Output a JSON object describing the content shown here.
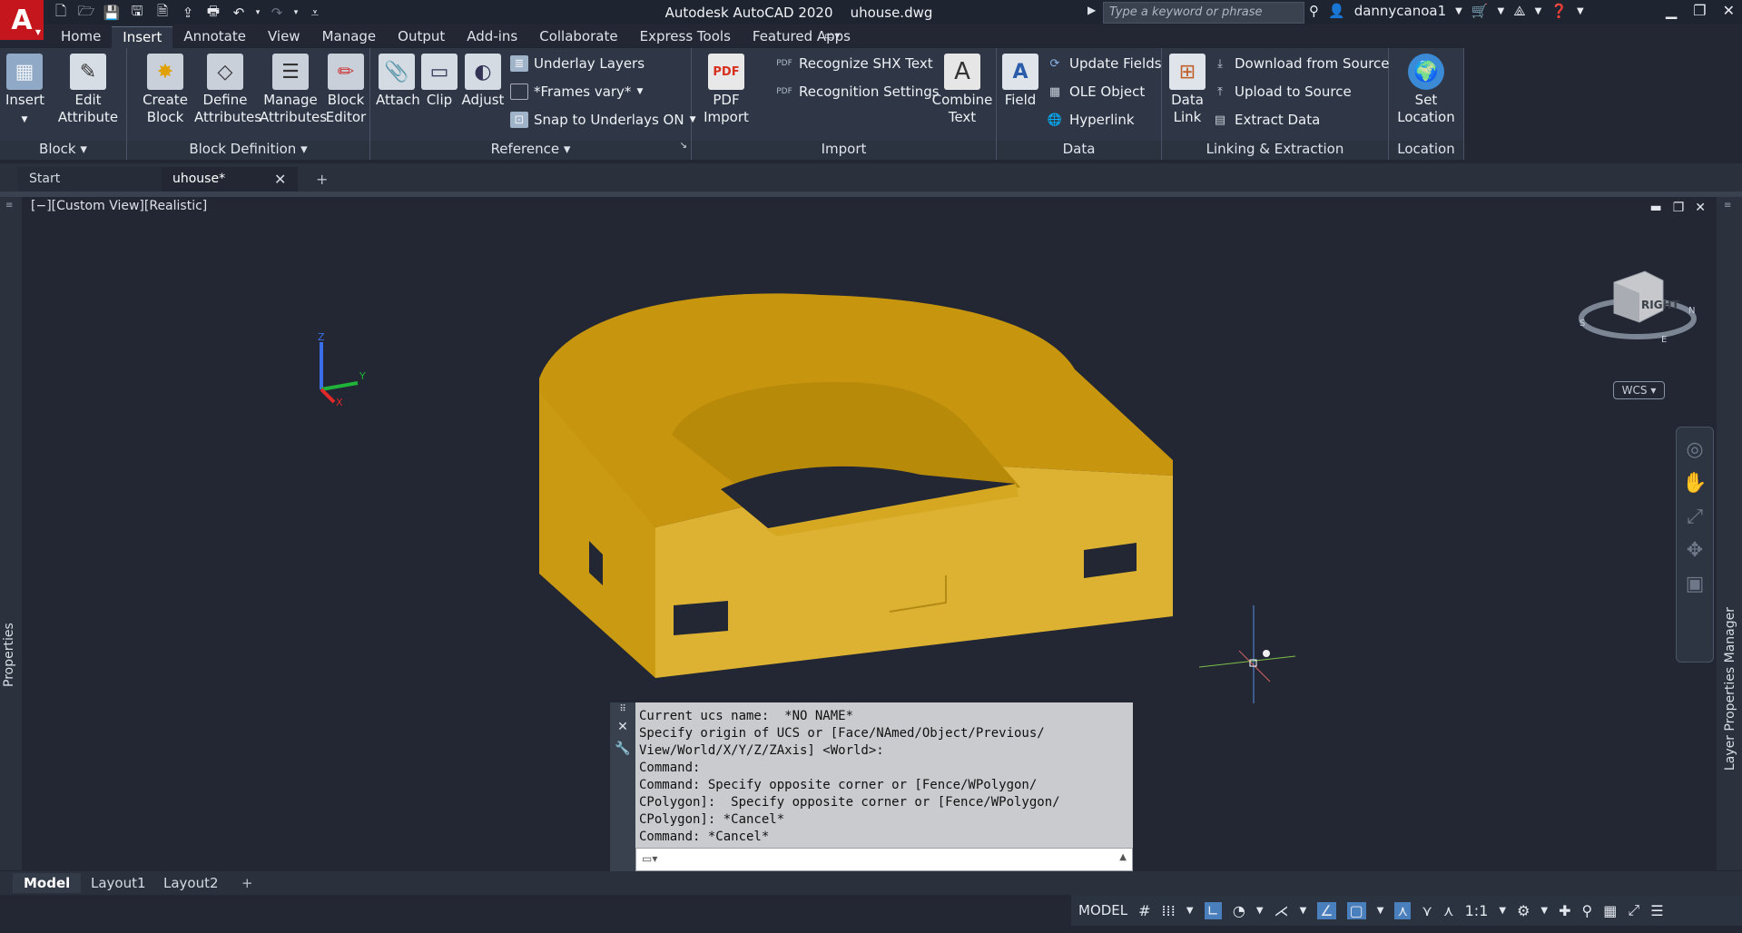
{
  "app": {
    "logo": "A",
    "title": "Autodesk AutoCAD 2020    uhouse.dwg",
    "search_placeholder": "Type a keyword or phrase",
    "username": "dannycanoa1"
  },
  "menu_tabs": [
    "Home",
    "Insert",
    "Annotate",
    "View",
    "Manage",
    "Output",
    "Add-ins",
    "Collaborate",
    "Express Tools",
    "Featured Apps"
  ],
  "active_menu_tab": "Insert",
  "ribbon": {
    "block": {
      "title": "Block",
      "insert": "Insert",
      "edit_attribute": [
        "Edit",
        "Attribute"
      ]
    },
    "block_definition": {
      "title": "Block Definition",
      "create_block": [
        "Create",
        "Block"
      ],
      "define_attributes": [
        "Define",
        "Attributes"
      ],
      "manage_attributes": [
        "Manage",
        "Attributes"
      ],
      "block_editor": [
        "Block",
        "Editor"
      ]
    },
    "reference": {
      "title": "Reference",
      "attach": "Attach",
      "clip": "Clip",
      "adjust": "Adjust",
      "underlay_layers": "Underlay Layers",
      "frames_vary": "*Frames vary*",
      "snap_to_underlays": "Snap to Underlays ON"
    },
    "import": {
      "title": "Import",
      "pdf_import": [
        "PDF",
        "Import"
      ],
      "recognize_shx": "Recognize SHX Text",
      "recognition_settings": "Recognition Settings",
      "combine_text": [
        "Combine",
        "Text"
      ]
    },
    "data": {
      "title": "Data",
      "field": "Field",
      "update_fields": "Update Fields",
      "ole_object": "OLE Object",
      "hyperlink": "Hyperlink"
    },
    "linking": {
      "title": "Linking & Extraction",
      "data_link": [
        "Data",
        "Link"
      ],
      "download_from_source": "Download from Source",
      "upload_to_source": "Upload to Source",
      "extract_data": "Extract  Data"
    },
    "location": {
      "title": "Location",
      "set_location": [
        "Set",
        "Location"
      ]
    }
  },
  "file_tabs": {
    "start": "Start",
    "current": "uhouse*"
  },
  "viewport": {
    "label": "[−][Custom View][Realistic]",
    "viewcube_face": "RIGHT",
    "wcs": "WCS"
  },
  "palettes": {
    "left": "Properties",
    "right": "Layer Properties Manager"
  },
  "command_history": [
    "Current ucs name:  *NO NAME*",
    "Specify origin of UCS or [Face/NAmed/Object/Previous/",
    "View/World/X/Y/Z/ZAxis] <World>:",
    "Command:",
    "Command: Specify opposite corner or [Fence/WPolygon/",
    "CPolygon]:  Specify opposite corner or [Fence/WPolygon/",
    "CPolygon]: *Cancel*",
    "Command: *Cancel*"
  ],
  "layout_tabs": [
    "Model",
    "Layout1",
    "Layout2"
  ],
  "status": {
    "model": "MODEL",
    "scale": "1:1"
  },
  "colors": {
    "model_gold": "#d9a921",
    "ribbon_bg": "#2f3746",
    "viewport_bg": "#222733"
  }
}
